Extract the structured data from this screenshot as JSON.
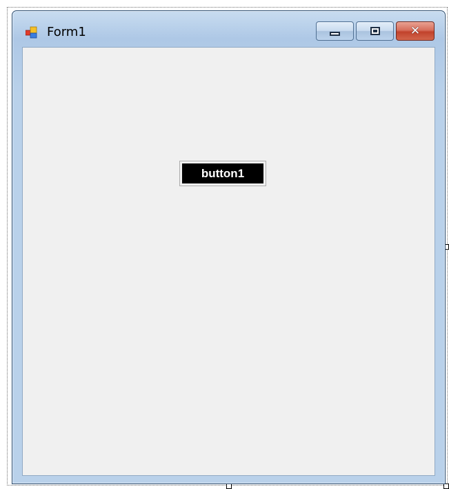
{
  "window": {
    "title": "Form1",
    "icon": "form-icon",
    "caption_buttons": {
      "minimize": "minimize-icon",
      "maximize": "maximize-icon",
      "close": "close-icon"
    }
  },
  "form": {
    "button1_label": "button1"
  },
  "colors": {
    "button_background": "#000000",
    "button_text": "#ffffff",
    "client_background": "#f0f0f0",
    "close_button": "#c1432c"
  }
}
